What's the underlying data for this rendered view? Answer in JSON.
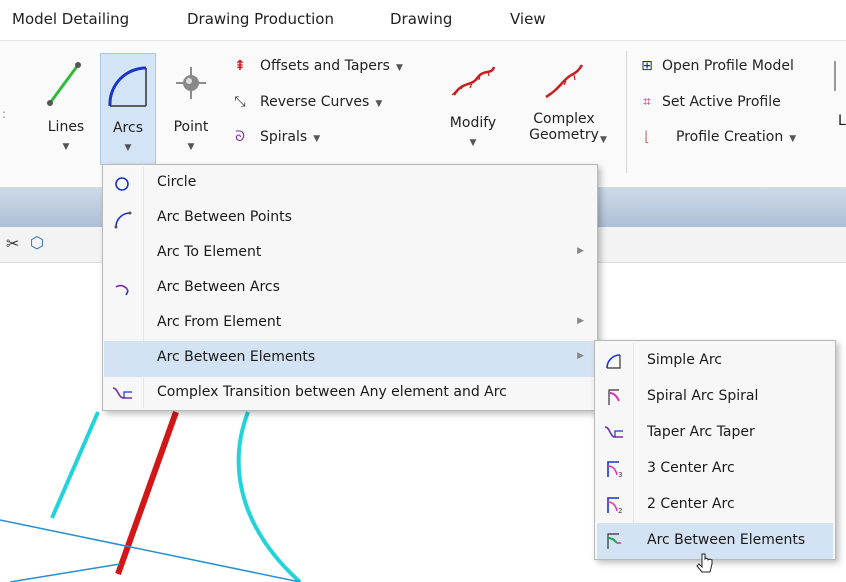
{
  "menubar": {
    "items": [
      "Model Detailing",
      "Drawing Production",
      "Drawing",
      "View"
    ]
  },
  "ribbon": {
    "lines_label": "Lines",
    "arcs_label": "Arcs",
    "point_label": "Point",
    "offsets_label": "Offsets and Tapers",
    "reverse_label": "Reverse Curves",
    "spirals_label": "Spirals",
    "modify_label": "Modify",
    "complex_label_1": "Complex",
    "complex_label_2": "Geometry",
    "open_profile_label": "Open Profile Model",
    "set_active_label": "Set Active Profile",
    "profile_creation_label": "Profile Creation",
    "truncated_label": "L"
  },
  "arcs_menu": {
    "items": [
      {
        "label": "Circle",
        "icon": "circle-icon",
        "submenu": false
      },
      {
        "label": "Arc Between Points",
        "icon": "arc-points-icon",
        "submenu": false
      },
      {
        "label": "Arc To Element",
        "icon": "",
        "submenu": true
      },
      {
        "label": "Arc Between Arcs",
        "icon": "arc-between-arcs-icon",
        "submenu": false
      },
      {
        "label": "Arc From Element",
        "icon": "",
        "submenu": true
      },
      {
        "label": "Arc Between Elements",
        "icon": "",
        "submenu": true,
        "highlighted": true
      },
      {
        "label": "Complex Transition between Any element and Arc",
        "icon": "complex-transition-icon",
        "submenu": false
      }
    ]
  },
  "submenu": {
    "items": [
      {
        "label": "Simple Arc",
        "icon": "simple-arc-icon"
      },
      {
        "label": "Spiral Arc Spiral",
        "icon": "spiral-arc-spiral-icon"
      },
      {
        "label": "Taper Arc Taper",
        "icon": "taper-arc-taper-icon"
      },
      {
        "label": "3 Center Arc",
        "icon": "three-center-arc-icon"
      },
      {
        "label": "2 Center Arc",
        "icon": "two-center-arc-icon"
      },
      {
        "label": "Arc Between Elements",
        "icon": "arc-between-elements-icon",
        "highlighted": true
      }
    ]
  },
  "colors": {
    "highlight": "#d4e3f3",
    "cyan_geometry": "#22d3d8",
    "red_geometry": "#d01818",
    "blue_geometry": "#2a8fd0"
  }
}
